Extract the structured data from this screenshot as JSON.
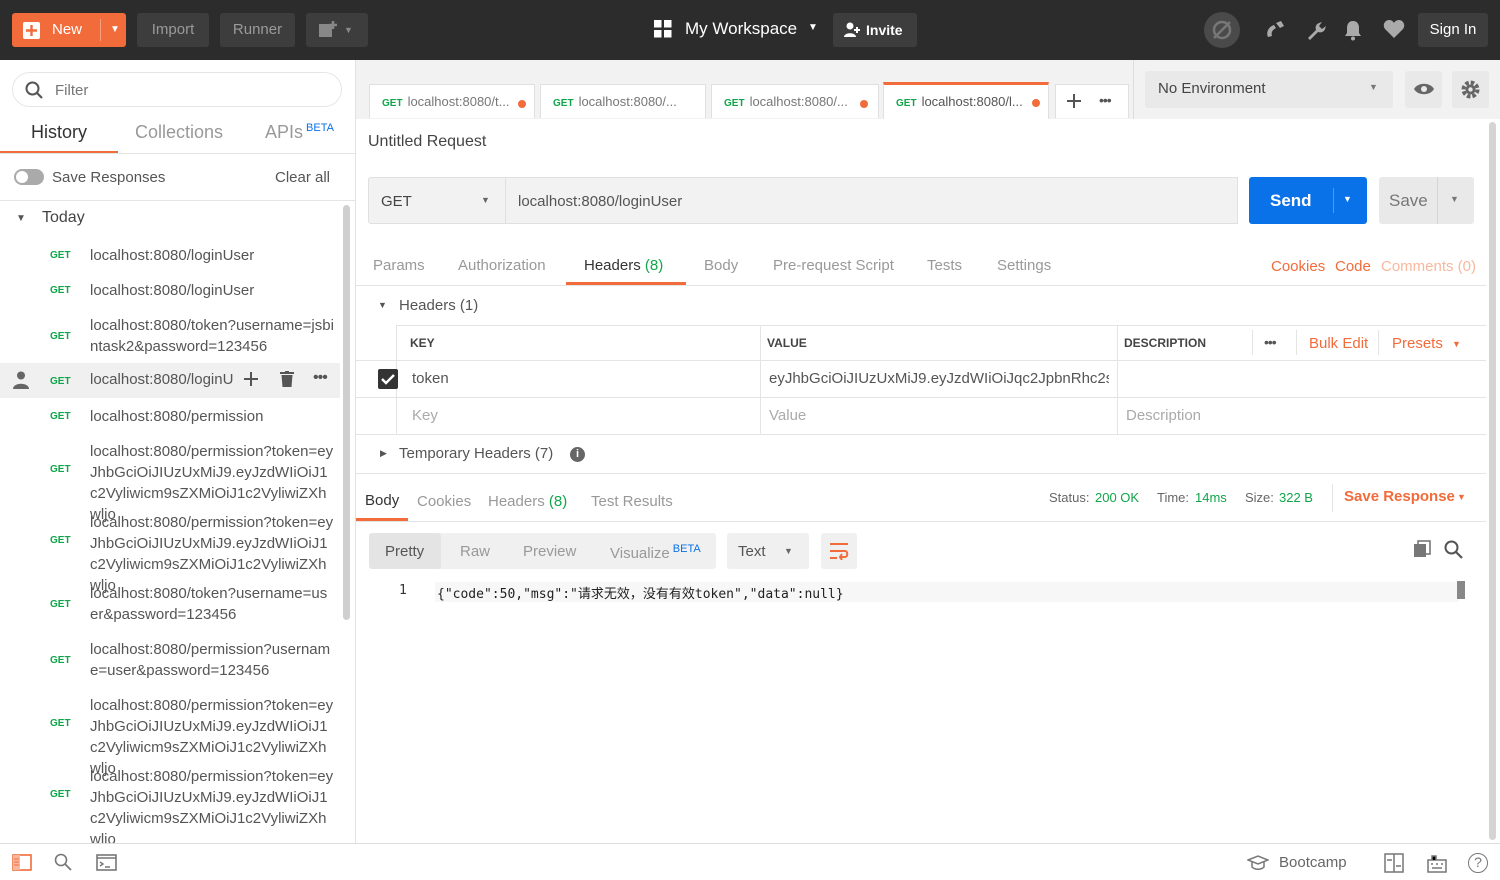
{
  "header": {
    "new_label": "New",
    "import_label": "Import",
    "runner_label": "Runner",
    "workspace_label": "My Workspace",
    "invite_label": "Invite",
    "signin_label": "Sign In"
  },
  "sidebar": {
    "filter_placeholder": "Filter",
    "tabs": {
      "history": "History",
      "collections": "Collections",
      "apis": "APIs",
      "apis_badge": "BETA"
    },
    "save_responses": "Save Responses",
    "clear_all": "Clear all",
    "group": "Today",
    "items": [
      {
        "method": "GET",
        "url": "localhost:8080/loginUser"
      },
      {
        "method": "GET",
        "url": "localhost:8080/loginUser"
      },
      {
        "method": "GET",
        "url": "localhost:8080/token?username=jsbintask2&password=123456"
      },
      {
        "method": "GET",
        "url": "localhost:8080/loginU"
      },
      {
        "method": "GET",
        "url": "localhost:8080/permission"
      },
      {
        "method": "GET",
        "url": "localhost:8080/permission?token=eyJhbGciOiJIUzUxMiJ9.eyJzdWIiOiJ1c2Vyliwicm9sZXMiOiJ1c2VyliwiZXhwljo"
      },
      {
        "method": "GET",
        "url": "localhost:8080/permission?token=eyJhbGciOiJIUzUxMiJ9.eyJzdWIiOiJ1c2Vyliwicm9sZXMiOiJ1c2VyliwiZXhwljo"
      },
      {
        "method": "GET",
        "url": "localhost:8080/token?username=user&password=123456"
      },
      {
        "method": "GET",
        "url": "localhost:8080/permission?username=user&password=123456"
      },
      {
        "method": "GET",
        "url": "localhost:8080/permission?token=eyJhbGciOiJIUzUxMiJ9.eyJzdWIiOiJ1c2Vyliwicm9sZXMiOiJ1c2VyliwiZXhwljo"
      },
      {
        "method": "GET",
        "url": "localhost:8080/permission?token=eyJhbGciOiJIUzUxMiJ9.eyJzdWIiOiJ1c2Vyliwicm9sZXMiOiJ1c2VyliwiZXhwljo"
      }
    ]
  },
  "tabs": [
    {
      "method": "GET",
      "label": "localhost:8080/t..."
    },
    {
      "method": "GET",
      "label": "localhost:8080/..."
    },
    {
      "method": "GET",
      "label": "localhost:8080/..."
    },
    {
      "method": "GET",
      "label": "localhost:8080/l..."
    }
  ],
  "environment": "No Environment",
  "request": {
    "name": "Untitled Request",
    "method": "GET",
    "url": "localhost:8080/loginUser",
    "send_label": "Send",
    "save_label": "Save",
    "subtabs": {
      "params": "Params",
      "authorization": "Authorization",
      "headers": "Headers",
      "headers_count": "(8)",
      "body": "Body",
      "prerequest": "Pre-request Script",
      "tests": "Tests",
      "settings": "Settings"
    },
    "links": {
      "cookies": "Cookies",
      "code": "Code",
      "comments": "Comments (0)"
    },
    "headers_section": "Headers (1)",
    "columns": {
      "key": "KEY",
      "value": "VALUE",
      "description": "DESCRIPTION"
    },
    "bulk_edit": "Bulk Edit",
    "presets": "Presets",
    "rows": [
      {
        "key": "token",
        "value": "eyJhbGciOiJIUzUxMiJ9.eyJzdWIiOiJqc2JpbnRhc2syli..."
      }
    ],
    "placeholders": {
      "key": "Key",
      "value": "Value",
      "description": "Description"
    },
    "temp_headers": "Temporary Headers (7)"
  },
  "response": {
    "tabs": {
      "body": "Body",
      "cookies": "Cookies",
      "headers": "Headers",
      "headers_count": "(8)",
      "tests": "Test Results"
    },
    "status_label": "Status:",
    "status": "200 OK",
    "time_label": "Time:",
    "time": "14ms",
    "size_label": "Size:",
    "size": "322 B",
    "save_response": "Save Response",
    "views": {
      "pretty": "Pretty",
      "raw": "Raw",
      "preview": "Preview",
      "visualize": "Visualize",
      "visualize_badge": "BETA"
    },
    "format": "Text",
    "line_no": "1",
    "body": "{\"code\":50,\"msg\":\"请求无效，没有有效token\",\"data\":null}"
  },
  "footer": {
    "bootcamp": "Bootcamp"
  }
}
